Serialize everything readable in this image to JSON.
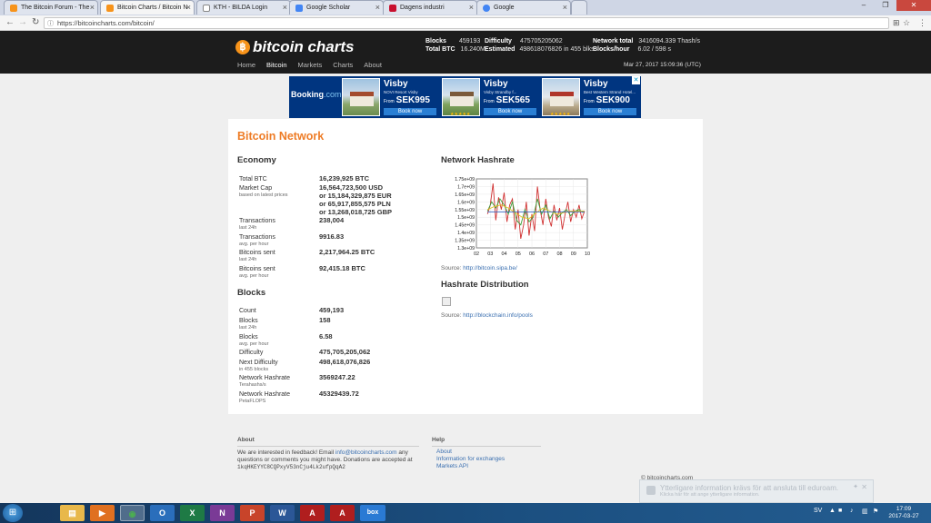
{
  "browser": {
    "tabs": [
      {
        "label": "The Bitcoin Forum - The",
        "favicon": "bitcoin-forum-icon",
        "color": "#f7931a"
      },
      {
        "label": "Bitcoin Charts / Bitcoin N",
        "favicon": "bitcoincharts-icon",
        "color": "#f7931a"
      },
      {
        "label": "KTH - BILDA Login",
        "favicon": "kth-icon",
        "color": "#888888"
      },
      {
        "label": "Google Scholar",
        "favicon": "google-scholar-icon",
        "color": "#4285f4"
      },
      {
        "label": "Dagens industri",
        "favicon": "di-icon",
        "color": "#c8102e"
      },
      {
        "label": "Google",
        "favicon": "google-icon",
        "color": "#4285f4"
      }
    ],
    "url": "https://bitcoincharts.com/bitcoin/"
  },
  "site": {
    "logo_symbol": "฿",
    "logo_text": "bitcoin charts",
    "nav": [
      "Home",
      "Bitcoin",
      "Markets",
      "Charts",
      "About"
    ],
    "active_nav": "Bitcoin",
    "header_stats": {
      "blocks_label": "Blocks",
      "blocks": "459193",
      "total_btc_label": "Total BTC",
      "total_btc": "16.240M",
      "difficulty_label": "Difficulty",
      "difficulty": "475705205062",
      "estimated_label": "Estimated",
      "estimated": "498618076826 in 455 blks",
      "network_total_label": "Network total",
      "network_total": "3416094.339 Thash/s",
      "blocks_hour_label": "Blocks/hour",
      "blocks_hour": "6.02 / 598 s"
    },
    "datetime": "Mar 27, 2017 15:09:36 (UTC)"
  },
  "ad": {
    "brand": "Booking",
    "brand_suffix": ".com",
    "units": [
      {
        "title": "Visby",
        "sub": "NOVI Resort Visby",
        "from": "From",
        "price": "SEK995",
        "cta": "Book now"
      },
      {
        "title": "Visby",
        "sub": "Visby Strandby f...",
        "from": "From",
        "price": "SEK565",
        "cta": "Book now"
      },
      {
        "title": "Visby",
        "sub": "Best Western Strand Hotel...",
        "from": "From",
        "price": "SEK900",
        "cta": "Book now"
      }
    ]
  },
  "page_title": "Bitcoin Network",
  "economy": {
    "heading": "Economy",
    "total_btc": {
      "label": "Total BTC",
      "value": "16,239,925 BTC"
    },
    "market_cap": {
      "label": "Market Cap",
      "sub": "based on latest prices",
      "usd": "16,564,723,500 USD",
      "eur": "or 15,184,329,875 EUR",
      "pln": "or 65,917,855,575 PLN",
      "gbp": "or 13,268,018,725 GBP"
    },
    "transactions_24h": {
      "label": "Transactions",
      "sub": "last 24h",
      "value": "238,004"
    },
    "transactions_hour": {
      "label": "Transactions",
      "sub": "avg. per hour",
      "value": "9916.83"
    },
    "bitcoins_sent_24h": {
      "label": "Bitcoins sent",
      "sub": "last 24h",
      "value": "2,217,964.25 BTC"
    },
    "bitcoins_sent_hour": {
      "label": "Bitcoins sent",
      "sub": "avg. per hour",
      "value": "92,415.18 BTC"
    }
  },
  "blocks": {
    "heading": "Blocks",
    "count": {
      "label": "Count",
      "value": "459,193"
    },
    "blocks_24h": {
      "label": "Blocks",
      "sub": "last 24h",
      "value": "158"
    },
    "blocks_hour": {
      "label": "Blocks",
      "sub": "avg. per hour",
      "value": "6.58"
    },
    "difficulty": {
      "label": "Difficulty",
      "value": "475,705,205,062"
    },
    "next_difficulty": {
      "label": "Next Difficulty",
      "sub": "in 455 blocks",
      "value": "498,618,076,826"
    },
    "hashrate_th": {
      "label": "Network Hashrate",
      "sub": "Terahashs/s",
      "value": "3569247.22"
    },
    "hashrate_pf": {
      "label": "Network Hashrate",
      "sub": "PetaFLOPS",
      "value": "45329439.72"
    }
  },
  "hashrate": {
    "heading": "Network Hashrate",
    "source_label": "Source:",
    "source_link": "http://bitcoin.sipa.be/",
    "distribution_heading": "Hashrate Distribution",
    "distribution_source_link": "http://blockchain.info/pools"
  },
  "chart_data": {
    "type": "line",
    "title": "",
    "xlabel": "",
    "ylabel": "",
    "x_ticks": [
      "02",
      "03",
      "04",
      "05",
      "06",
      "07",
      "08",
      "09",
      "10"
    ],
    "y_ticks": [
      "1.3e+09",
      "1.35e+09",
      "1.4e+09",
      "1.45e+09",
      "1.5e+09",
      "1.55e+09",
      "1.6e+09",
      "1.65e+09",
      "1.7e+09",
      "1.75e+09"
    ],
    "ylim": [
      1300000000,
      1750000000
    ],
    "xlim": [
      2,
      10
    ],
    "grid": true,
    "series": [
      {
        "color": "#d03030",
        "x": [
          2.8,
          3.0,
          3.2,
          3.4,
          3.6,
          3.8,
          4.0,
          4.2,
          4.4,
          4.6,
          4.8,
          5.0,
          5.2,
          5.4,
          5.6,
          5.8,
          6.0,
          6.2,
          6.4,
          6.6,
          6.8,
          7.0,
          7.2,
          7.4,
          7.6,
          7.8,
          8.0,
          8.2,
          8.4,
          8.6,
          8.8,
          9.0,
          9.2,
          9.4,
          9.6,
          9.8
        ],
        "values": [
          1520000000.0,
          1580000000.0,
          1720000000.0,
          1480000000.0,
          1630000000.0,
          1550000000.0,
          1660000000.0,
          1470000000.0,
          1580000000.0,
          1620000000.0,
          1420000000.0,
          1550000000.0,
          1360000000.0,
          1450000000.0,
          1600000000.0,
          1380000000.0,
          1520000000.0,
          1410000000.0,
          1700000000.0,
          1550000000.0,
          1450000000.0,
          1620000000.0,
          1500000000.0,
          1440000000.0,
          1580000000.0,
          1480000000.0,
          1560000000.0,
          1420000000.0,
          1520000000.0,
          1600000000.0,
          1470000000.0,
          1550000000.0,
          1500000000.0,
          1580000000.0,
          1490000000.0,
          1540000000.0
        ]
      },
      {
        "color": "#3aa03a",
        "x": [
          2.8,
          3.1,
          3.4,
          3.7,
          4.0,
          4.3,
          4.6,
          4.9,
          5.2,
          5.5,
          5.8,
          6.1,
          6.4,
          6.7,
          7.0,
          7.3,
          7.6,
          7.9,
          8.2,
          8.5,
          8.8,
          9.1,
          9.4,
          9.7
        ],
        "values": [
          1540000000.0,
          1600000000.0,
          1560000000.0,
          1620000000.0,
          1580000000.0,
          1520000000.0,
          1600000000.0,
          1480000000.0,
          1450000000.0,
          1550000000.0,
          1470000000.0,
          1500000000.0,
          1620000000.0,
          1520000000.0,
          1580000000.0,
          1490000000.0,
          1540000000.0,
          1500000000.0,
          1530000000.0,
          1550000000.0,
          1510000000.0,
          1540000000.0,
          1550000000.0,
          1530000000.0
        ]
      },
      {
        "color": "#e0c020",
        "x": [
          2.8,
          3.3,
          3.8,
          4.3,
          4.8,
          5.3,
          5.8,
          6.3,
          6.8,
          7.3,
          7.8,
          8.3,
          8.8,
          9.3,
          9.8
        ],
        "values": [
          1550000000.0,
          1570000000.0,
          1580000000.0,
          1560000000.0,
          1530000000.0,
          1500000000.0,
          1490000000.0,
          1530000000.0,
          1560000000.0,
          1540000000.0,
          1520000000.0,
          1530000000.0,
          1540000000.0,
          1540000000.0,
          1540000000.0
        ]
      },
      {
        "color": "#3060c0",
        "x": [
          2.8,
          9.8
        ],
        "values": [
          1535000000.0,
          1535000000.0
        ]
      }
    ]
  },
  "footer": {
    "about_heading": "About",
    "about_text_1": "We are interested in feedback! Email",
    "about_email": "info@bitcoincharts.com",
    "about_text_2": "any",
    "about_text_3": "questions or comments you might have. Donations are accepted at",
    "about_address": "1kqHKEYYC8CQPxyV53nCju4Lk2ufpQqA2",
    "help_heading": "Help",
    "help_links": [
      "About",
      "Information for exchanges",
      "Markets API"
    ],
    "copyright": "© bitcoincharts.com"
  },
  "notification": {
    "title": "Ytterligare information krävs för att ansluta till eduroam.",
    "sub": "Klicka här för att ange ytterligare information."
  },
  "taskbar": {
    "apps": [
      {
        "name": "file-explorer-icon",
        "glyph": "▤",
        "color": "#e8b84a"
      },
      {
        "name": "media-player-icon",
        "glyph": "▶",
        "color": "#e07020"
      },
      {
        "name": "chrome-icon",
        "glyph": "◉",
        "color": "#4caf50"
      },
      {
        "name": "outlook-icon",
        "glyph": "O",
        "color": "#2a6ebb"
      },
      {
        "name": "excel-icon",
        "glyph": "X",
        "color": "#1e7a45"
      },
      {
        "name": "onenote-icon",
        "glyph": "N",
        "color": "#7a3a96"
      },
      {
        "name": "powerpoint-icon",
        "glyph": "P",
        "color": "#c8442a"
      },
      {
        "name": "word-icon",
        "glyph": "W",
        "color": "#2b5797"
      },
      {
        "name": "acrobat-icon",
        "glyph": "A",
        "color": "#b01e1e"
      },
      {
        "name": "acrobat-reader-icon",
        "glyph": "A",
        "color": "#b01e1e"
      },
      {
        "name": "box-icon",
        "glyph": "box",
        "color": "#2a7ad4"
      }
    ],
    "language": "SV",
    "time": "17:09",
    "date": "2017-03-27"
  }
}
